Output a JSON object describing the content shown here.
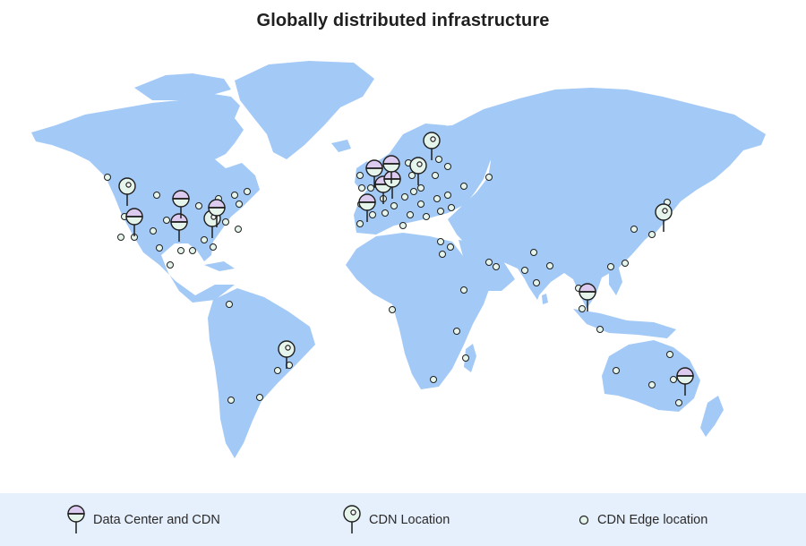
{
  "title": "Globally distributed infrastructure",
  "colors": {
    "land": "#a3c9f7",
    "background": "#ffffff",
    "legend_bg": "#e6effc",
    "pin_top_purple": "#dccbef",
    "pin_fill_mint": "#e6f5ec",
    "outline": "#1f1f1f"
  },
  "legend": [
    {
      "key": "dc",
      "label": "Data Center and CDN",
      "icon": "data-center-pin-icon"
    },
    {
      "key": "cdn",
      "label": "CDN Location",
      "icon": "cdn-pin-icon"
    },
    {
      "key": "edge",
      "label": "CDN Edge location",
      "icon": "edge-dot-icon"
    }
  ],
  "markers": {
    "data_center": [
      {
        "region": "US West"
      },
      {
        "region": "US Central"
      },
      {
        "region": "US South"
      },
      {
        "region": "US East"
      },
      {
        "region": "UK"
      },
      {
        "region": "Netherlands"
      },
      {
        "region": "Germany"
      },
      {
        "region": "Scandinavia"
      },
      {
        "region": "France"
      },
      {
        "region": "Singapore"
      },
      {
        "region": "Australia"
      }
    ],
    "cdn": [
      {
        "region": "Pacific Northwest"
      },
      {
        "region": "US Atlanta"
      },
      {
        "region": "Finland"
      },
      {
        "region": "Sweden"
      },
      {
        "region": "Japan"
      },
      {
        "region": "Brazil"
      }
    ],
    "edge_count": 79
  }
}
